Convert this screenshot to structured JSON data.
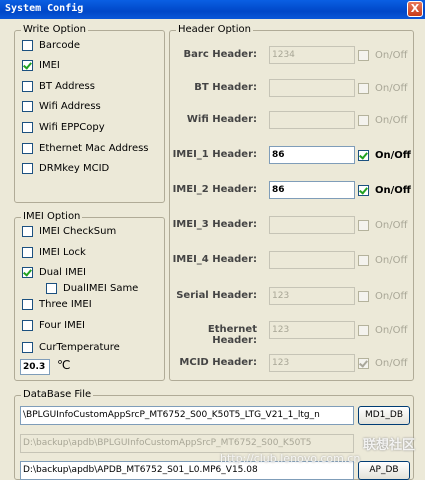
{
  "window": {
    "title": "System Config",
    "close_glyph": "X"
  },
  "write_option": {
    "title": "Write Option",
    "items": [
      {
        "label": "Barcode",
        "checked": false
      },
      {
        "label": "IMEI",
        "checked": true
      },
      {
        "label": "BT Address",
        "checked": false
      },
      {
        "label": "Wifi Address",
        "checked": false
      },
      {
        "label": "Wifi EPPCopy",
        "checked": false
      },
      {
        "label": "Ethernet Mac Address",
        "checked": false
      },
      {
        "label": "DRMkey MCID",
        "checked": false
      }
    ]
  },
  "imei_option": {
    "title": "IMEI Option",
    "items": [
      {
        "label": "IMEI CheckSum",
        "checked": false
      },
      {
        "label": "IMEI Lock",
        "checked": false
      },
      {
        "label": "Dual IMEI",
        "checked": true
      },
      {
        "label": "DualIMEI Same",
        "checked": false
      },
      {
        "label": "Three IMEI",
        "checked": false
      },
      {
        "label": "Four IMEI",
        "checked": false
      },
      {
        "label": "CurTemperature",
        "checked": false
      }
    ],
    "temperature_value": "20.3",
    "temperature_unit": "℃"
  },
  "header_option": {
    "title": "Header Option",
    "rows": [
      {
        "label": "Barc Header:",
        "value": "1234",
        "enabled": false,
        "toggle": "On/Off",
        "checked": false
      },
      {
        "label": "BT Header:",
        "value": "",
        "enabled": false,
        "toggle": "On/Off",
        "checked": false
      },
      {
        "label": "Wifi Header:",
        "value": "",
        "enabled": false,
        "toggle": "On/Off",
        "checked": false
      },
      {
        "label": "IMEI_1 Header:",
        "value": "86",
        "enabled": true,
        "toggle": "On/Off",
        "checked": true
      },
      {
        "label": "IMEI_2 Header:",
        "value": "86",
        "enabled": true,
        "toggle": "On/Off",
        "checked": true
      },
      {
        "label": "IMEI_3 Header:",
        "value": "",
        "enabled": false,
        "toggle": "On/Off",
        "checked": false
      },
      {
        "label": "IMEI_4 Header:",
        "value": "",
        "enabled": false,
        "toggle": "On/Off",
        "checked": false
      },
      {
        "label": "Serial Header:",
        "value": "123",
        "enabled": false,
        "toggle": "On/Off",
        "checked": false
      },
      {
        "label": "Ethernet Header:",
        "value": "123",
        "enabled": false,
        "toggle": "On/Off",
        "checked": false
      },
      {
        "label": "MCID Header:",
        "value": "123",
        "enabled": false,
        "toggle": "On/Off",
        "checked": true
      }
    ]
  },
  "database": {
    "title": "DataBase File",
    "md1_path": "\\BPLGUInfoCustomAppSrcP_MT6752_S00_K50T5_LTG_V21_1_ltg_n",
    "md1_button": "MD1_DB",
    "md2_path": "D:\\backup\\apdb\\BPLGUInfoCustomAppSrcP_MT6752_S00_K50T5",
    "ap_path": "D:\\backup\\apdb\\APDB_MT6752_S01_L0.MP6_V15.08",
    "ap_button": "AP_DB"
  },
  "watermark": {
    "site": "联想社区",
    "url": "http://club.lenovo.com.cn"
  }
}
